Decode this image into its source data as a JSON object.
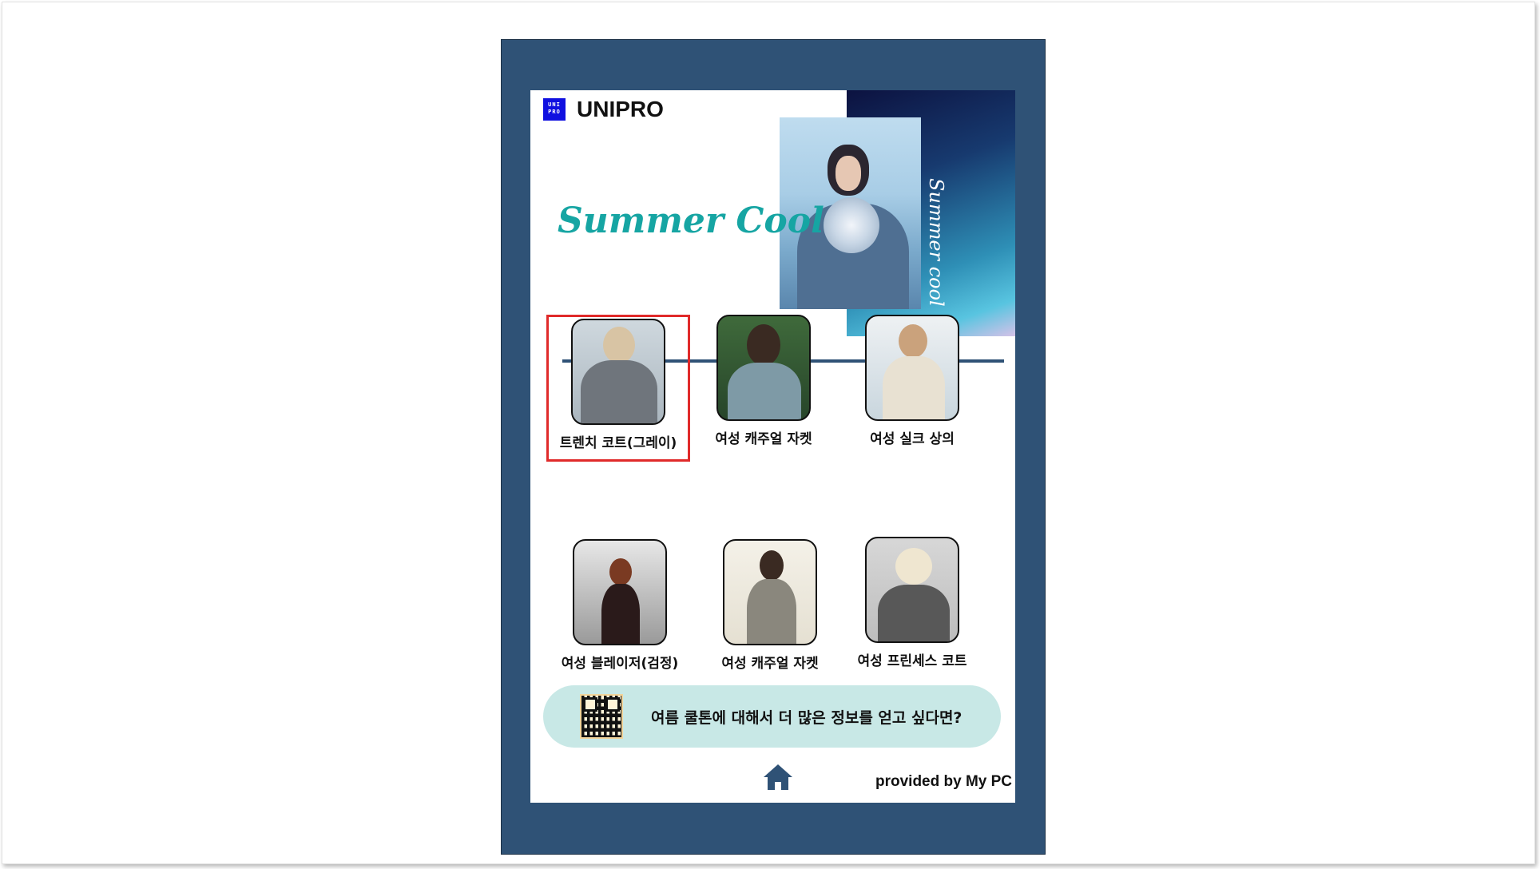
{
  "brand": {
    "logo_mark": "UNI PRO",
    "name": "UNIPRO"
  },
  "hero": {
    "headline": "Summer Cool",
    "side_text": "Summer cool"
  },
  "products": [
    {
      "label": "트렌치 코트(그레이)",
      "selected": true
    },
    {
      "label": "여성 캐주얼 자켓",
      "selected": false
    },
    {
      "label": "여성 실크 상의",
      "selected": false
    },
    {
      "label": "여성 블레이저(검정)",
      "selected": false
    },
    {
      "label": "여성 캐주얼 자켓",
      "selected": false
    },
    {
      "label": "여성 프린세스 코트",
      "selected": false
    }
  ],
  "info_bar": {
    "text": "여름 쿨톤에 대해서 더 많은 정보를 얻고 싶다면?"
  },
  "footer": {
    "home_icon": "home-icon",
    "provided_by": "provided by My PC"
  },
  "colors": {
    "frame": "#2f5276",
    "accent_teal": "#16a5a3",
    "info_bg": "#c8e8e6",
    "selection": "#e02a2a"
  }
}
